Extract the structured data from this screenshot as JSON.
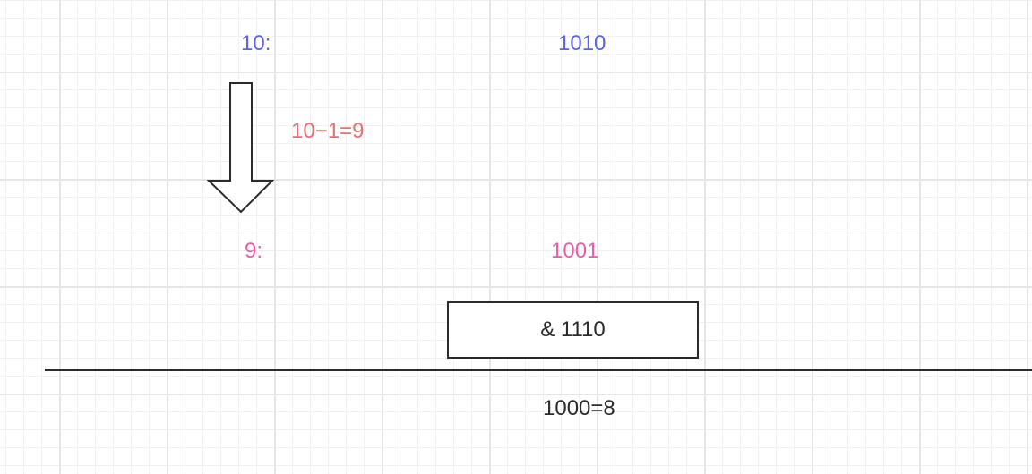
{
  "steps": {
    "ten_label": "10:",
    "ten_binary": "1010",
    "subtract_label": "10−1=9",
    "nine_label": "9:",
    "nine_binary": "1001",
    "and_operation": "& 1110",
    "result": "1000=8"
  },
  "colors": {
    "ten": "#5b63e6",
    "subtract": "#e8706f",
    "nine": "#e85fa8",
    "text": "#2b2b2b"
  },
  "icons": {
    "arrow": "arrow-down-icon"
  }
}
